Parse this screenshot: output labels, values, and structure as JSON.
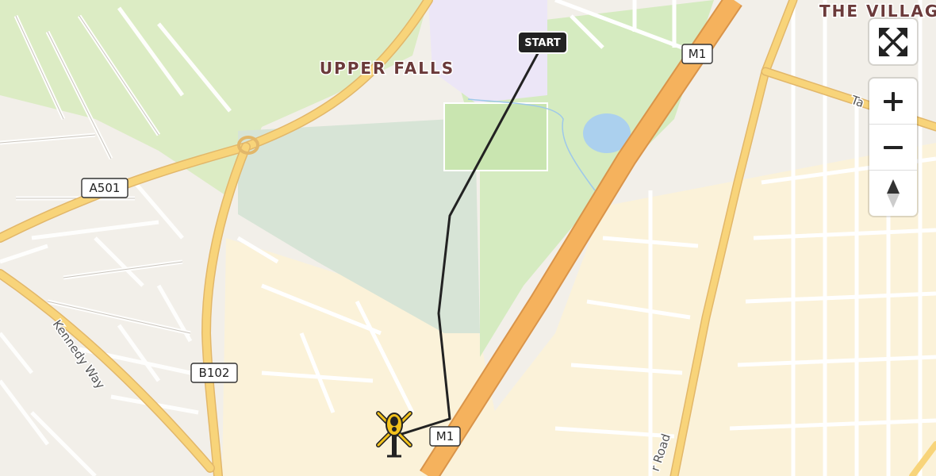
{
  "map": {
    "places": [
      {
        "name": "UPPER FALLS"
      },
      {
        "name": "THE VILLAG"
      }
    ],
    "road_shields": [
      "A501",
      "M1",
      "B102",
      "M1"
    ],
    "street_labels": [
      "Kennedy Way",
      "Ta",
      "r Road"
    ],
    "route": {
      "start_label": "START",
      "line_color": "#222222"
    },
    "colors": {
      "motorway": "#f5b25d",
      "primary": "#f8d47a",
      "park": "#dcecc4",
      "grass": "#d7e4d6",
      "residential": "#f2efe9",
      "industrial": "#fbf2d9",
      "water": "#abd0ee",
      "school": "#ece6f7"
    }
  },
  "controls": {
    "fullscreen_icon": "fullscreen-icon",
    "zoom_in_icon": "plus-icon",
    "zoom_out_icon": "minus-icon",
    "compass_icon": "compass-icon"
  },
  "marker": {
    "icon": "helicopter-icon",
    "color": "#f2c21b"
  }
}
